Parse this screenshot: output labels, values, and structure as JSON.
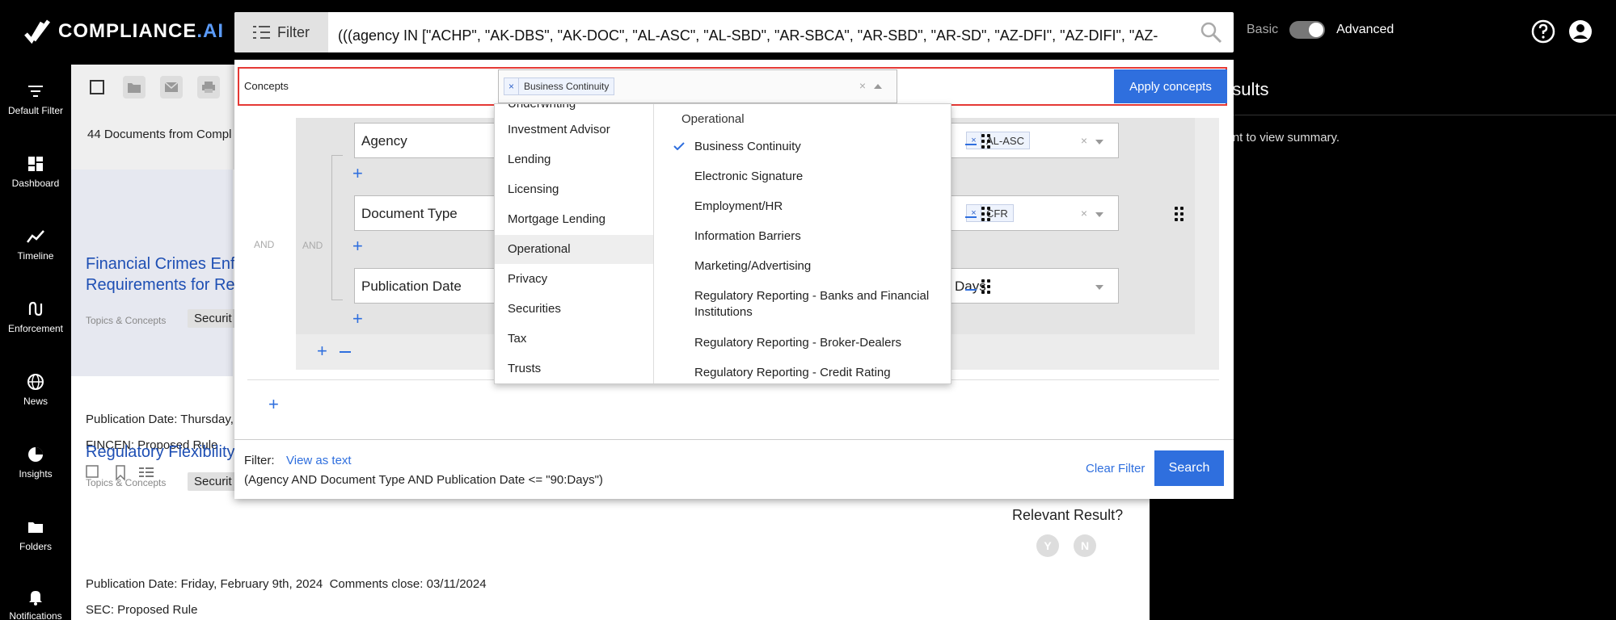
{
  "brand": {
    "name": "COMPLIANCE",
    "suffix": ".AI"
  },
  "search": {
    "filter_button": "Filter",
    "query": "(((agency IN [\"ACHP\", \"AK-DBS\", \"AK-DOC\", \"AL-ASC\", \"AL-SBD\", \"AR-SBCA\", \"AR-SBD\", \"AR-SD\", \"AZ-DFI\", \"AZ-DIFI\", \"AZ-SD\", \"BHR-CBB\","
  },
  "mode": {
    "basic": "Basic",
    "advanced": "Advanced"
  },
  "sidebar": [
    {
      "label": "Default Filter",
      "icon": "filter-icon"
    },
    {
      "label": "Dashboard",
      "icon": "dashboard-icon"
    },
    {
      "label": "Timeline",
      "icon": "timeline-icon"
    },
    {
      "label": "Enforcement",
      "icon": "enforcement-icon"
    },
    {
      "label": "News",
      "icon": "globe-icon"
    },
    {
      "label": "Insights",
      "icon": "pie-chart-icon"
    },
    {
      "label": "Folders",
      "icon": "folder-icon"
    },
    {
      "label": "Notifications",
      "icon": "bell-icon"
    }
  ],
  "main": {
    "doc_count": "44 Documents from Compl",
    "docs": [
      {
        "title_line1": "Financial Crimes Enfo",
        "title_line2": "Requirements for Reg",
        "topics_label": "Topics & Concepts",
        "tag": "Securit",
        "pub_date": "Publication Date: Thursday,",
        "source": "FINCEN:  Proposed Rule"
      },
      {
        "title_line1": "Regulatory Flexibility",
        "topics_label": "Topics & Concepts",
        "tag": "Securit",
        "pub_date": "Publication Date: Friday, February 9th, 2024",
        "comments": "Comments close:  03/11/2024",
        "source": "SEC:  Proposed Rule"
      }
    ],
    "relevant": {
      "label": "Relevant Result?",
      "yes": "Y",
      "no": "N"
    }
  },
  "right_panel": {
    "title": "esults",
    "hint": "ment to view summary."
  },
  "modal": {
    "concepts_label": "Concepts",
    "selected_concept": "Business Continuity",
    "apply_button": "Apply concepts",
    "builder": {
      "and_outer": "AND",
      "and_inner": "AND",
      "rows": [
        {
          "field": "Agency",
          "value": "AL-ASC"
        },
        {
          "field": "Document Type",
          "value": "CFR"
        },
        {
          "field": "Publication Date",
          "value": "Days"
        }
      ]
    },
    "footer": {
      "filter_label": "Filter:",
      "view_as_text": "View as text",
      "expression": "(Agency AND Document Type AND Publication Date <= \"90:Days\")",
      "clear_filter": "Clear Filter",
      "search_button": "Search"
    }
  },
  "dropdown": {
    "categories": [
      "Investment Advisor",
      "Lending",
      "Licensing",
      "Mortgage Lending",
      "Operational",
      "Privacy",
      "Securities",
      "Tax",
      "Trusts"
    ],
    "active_category": "Operational",
    "group_heading": "Operational",
    "options": [
      {
        "label": "Business Continuity",
        "checked": true
      },
      {
        "label": "Electronic Signature",
        "checked": false
      },
      {
        "label": "Employment/HR",
        "checked": false
      },
      {
        "label": "Information Barriers",
        "checked": false
      },
      {
        "label": "Marketing/Advertising",
        "checked": false
      },
      {
        "label": "Regulatory Reporting - Banks and Financial Institutions",
        "checked": false
      },
      {
        "label": "Regulatory Reporting - Broker-Dealers",
        "checked": false
      },
      {
        "label": "Regulatory Reporting - Credit Rating",
        "checked": false
      }
    ]
  },
  "colors": {
    "accent": "#2f6fde",
    "highlight_border": "#e53935",
    "brand_ai": "#5b9bf8"
  }
}
